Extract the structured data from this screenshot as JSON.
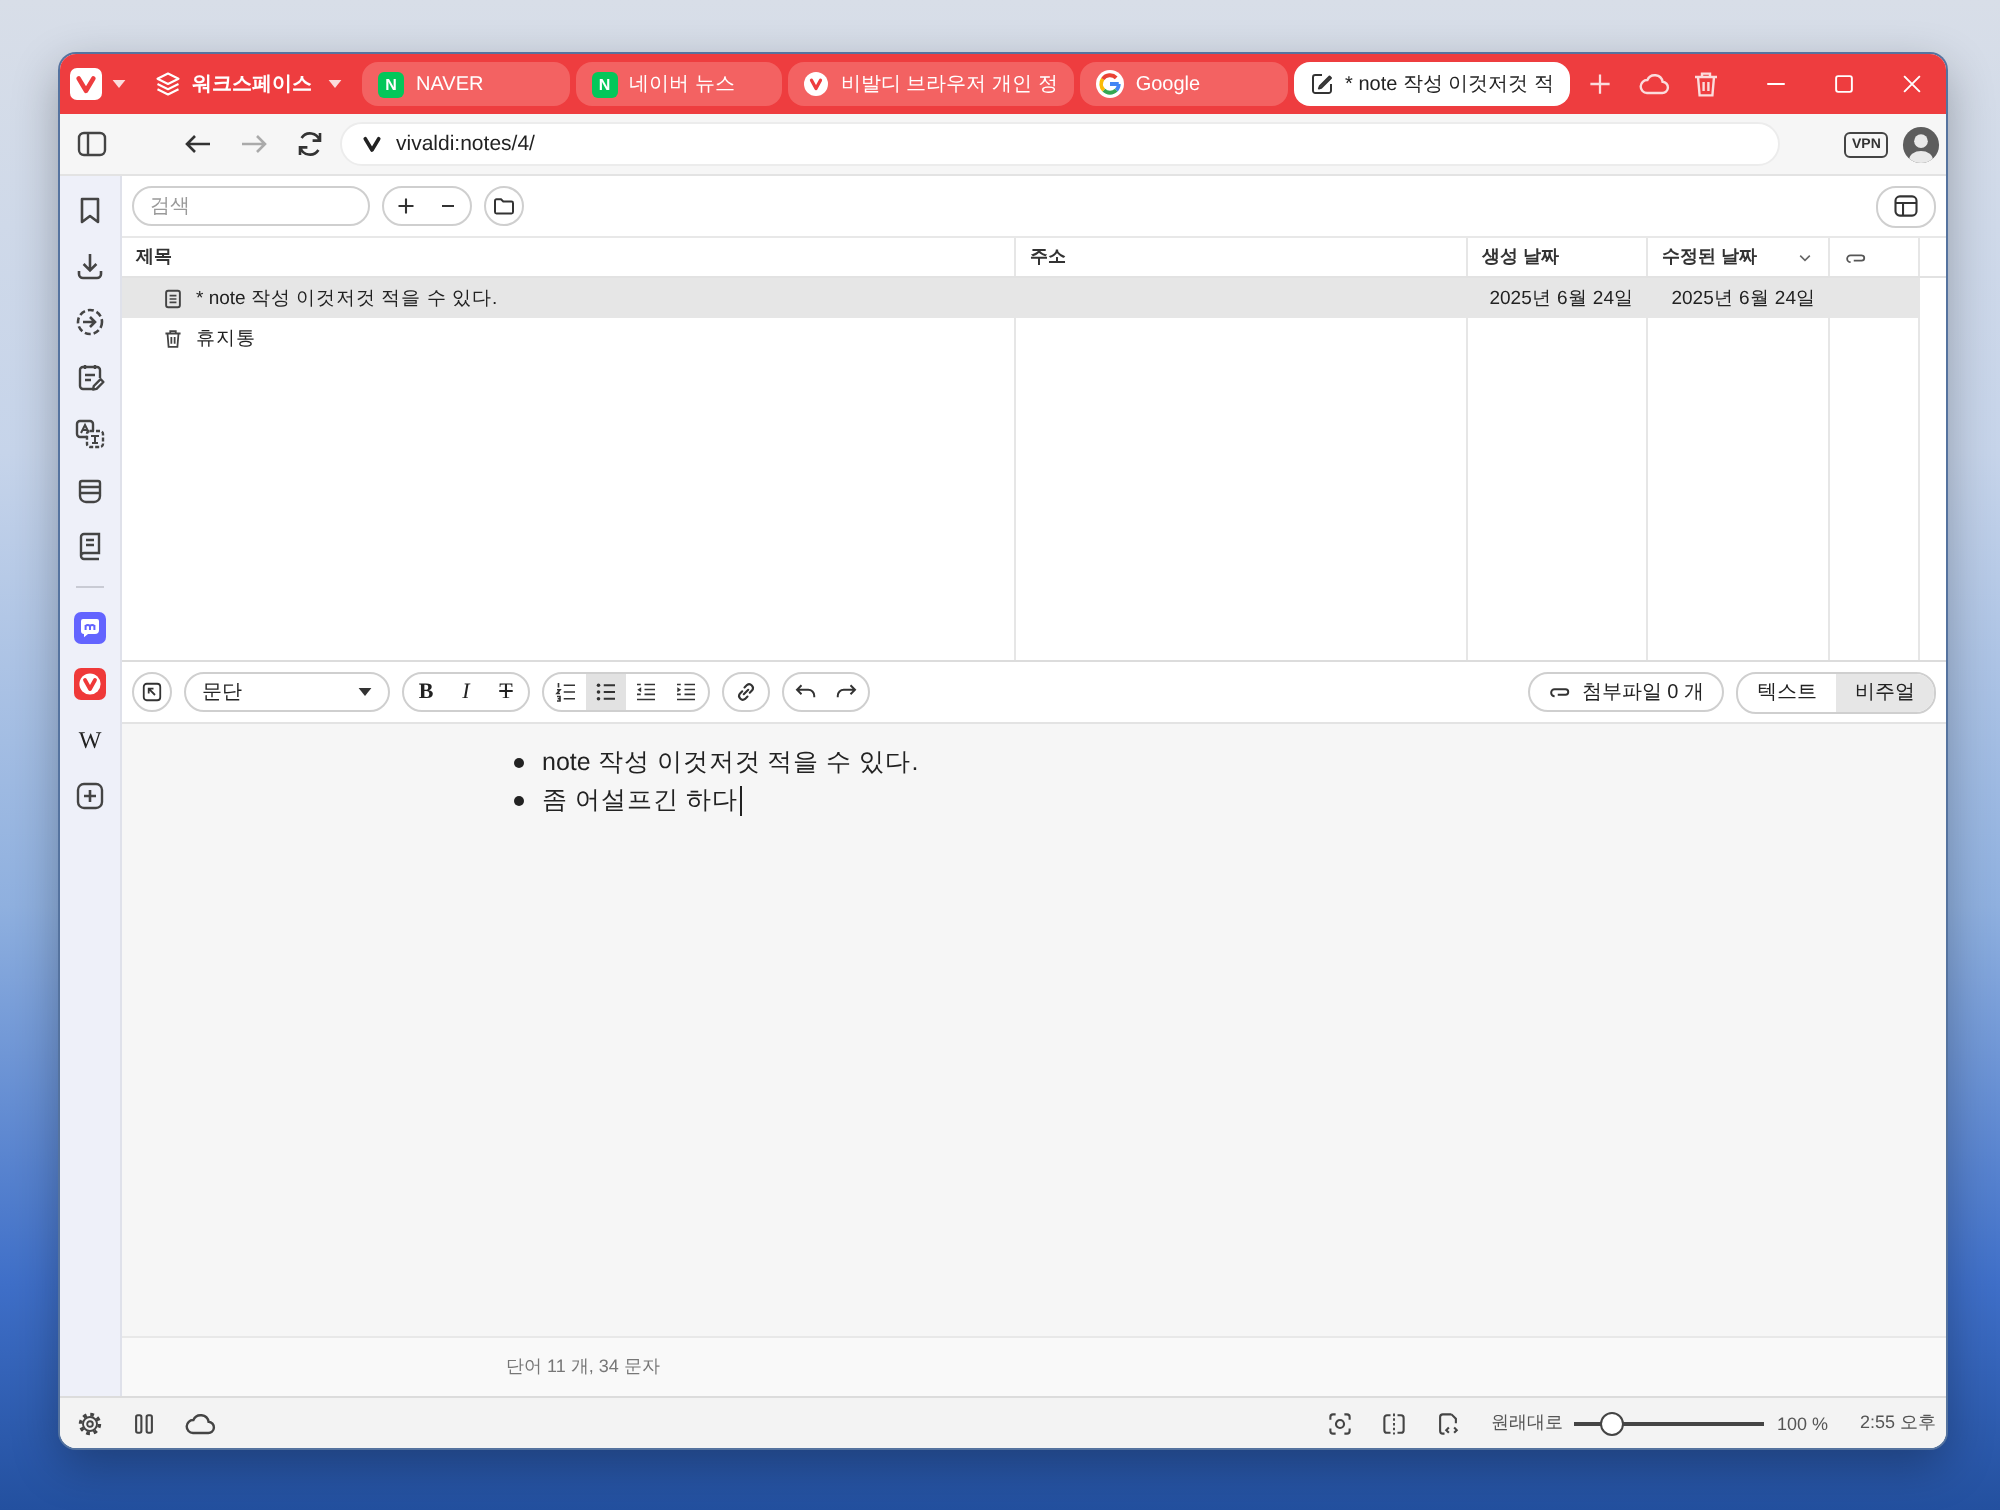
{
  "title_bar": {
    "workspace": "워크스페이스",
    "tabs": [
      {
        "kind": "naver",
        "favicon_glyph": "N",
        "label": "NAVER",
        "selected": false
      },
      {
        "kind": "naver",
        "favicon_glyph": "N",
        "label": "네이버 뉴스",
        "selected": false
      },
      {
        "kind": "vivaldi",
        "label": "비발디 브라우저 개인 정",
        "selected": false
      },
      {
        "kind": "google",
        "label": "Google",
        "selected": false
      },
      {
        "kind": "note",
        "label": "* note 작성 이것저것 적",
        "selected": true
      }
    ]
  },
  "address_bar": {
    "url": "vivaldi:notes/4/",
    "vpn_badge": "VPN"
  },
  "sidebar": {
    "web_panels": [
      {
        "kind": "mastodon"
      },
      {
        "kind": "vivaldi"
      },
      {
        "kind": "wikipedia",
        "glyph": "W"
      }
    ]
  },
  "notes": {
    "search": {
      "placeholder": "검색"
    },
    "columns": [
      {
        "label": "제목",
        "sorted": false
      },
      {
        "label": "주소",
        "sorted": false
      },
      {
        "label": "생성 날짜",
        "sorted": false
      },
      {
        "label": "수정된 날짜",
        "sorted": true
      }
    ],
    "rows": [
      {
        "kind": "note",
        "title": "* note 작성 이것저것 적을 수 있다.",
        "created": "2025년 6월 24일",
        "modified": "2025년 6월 24일",
        "selected": true
      },
      {
        "kind": "trash",
        "title": "휴지통",
        "selected": false
      }
    ]
  },
  "editor": {
    "block_format": "문단",
    "tool_groups": [
      [
        {
          "kind": "bold",
          "glyph": "B",
          "on": false
        },
        {
          "kind": "italic",
          "glyph": "I",
          "on": false
        },
        {
          "kind": "strikethrough",
          "glyph": "T",
          "on": false
        }
      ],
      [
        {
          "kind": "ordered-list",
          "on": false
        },
        {
          "kind": "bullet-list",
          "on": true
        },
        {
          "kind": "outdent",
          "on": false
        },
        {
          "kind": "indent",
          "on": false
        }
      ],
      [
        {
          "kind": "link",
          "on": false
        }
      ],
      [
        {
          "kind": "undo",
          "on": false
        },
        {
          "kind": "redo",
          "on": false
        }
      ]
    ],
    "attachments": "첨부파일 0 개",
    "modes": [
      {
        "label": "텍스트",
        "selected": false
      },
      {
        "label": "비주얼",
        "selected": true
      }
    ],
    "content": [
      "note 작성 이것저것 적을 수 있다.",
      "좀 어설프긴 하다"
    ],
    "word_count": "단어 11 개, 34 문자"
  },
  "status_bar": {
    "reset_zoom": "원래대로",
    "zoom": {
      "level": 0.2
    },
    "zoom_reading": "100 %",
    "clock": "2:55 오후"
  }
}
